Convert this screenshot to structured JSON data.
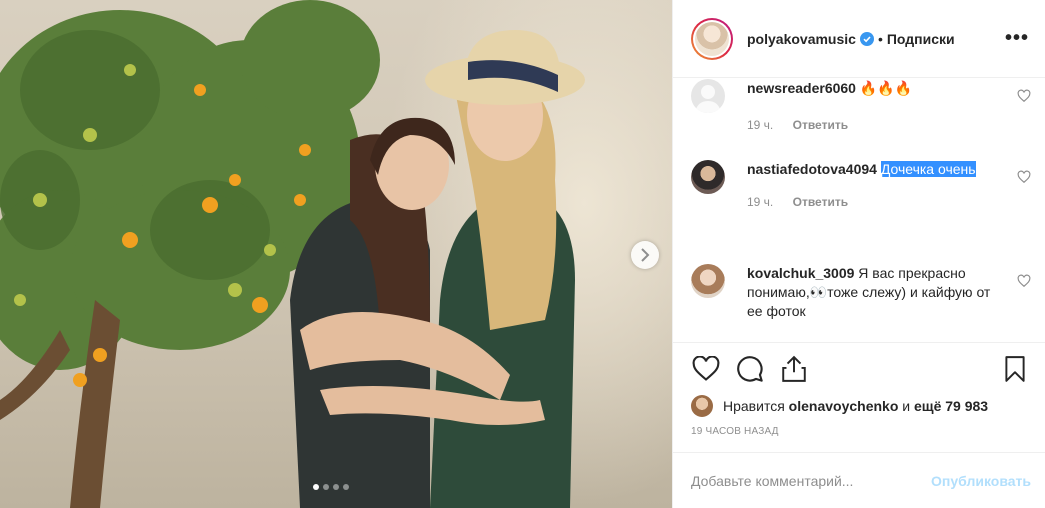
{
  "header": {
    "username": "polyakovamusic",
    "bullet": "•",
    "follow_label": "Подписки",
    "more_label": "•••"
  },
  "comments": [
    {
      "user": "newsreader6060",
      "text": "🔥🔥🔥",
      "time": "19 ч.",
      "reply": "Ответить"
    },
    {
      "user": "nastiafedotova4094",
      "text": "Дочечка очень",
      "time": "19 ч.",
      "reply": "Ответить"
    },
    {
      "user": "kovalchuk_3009",
      "text": "Я вас прекрасно понимаю,👀тоже слежу) и кайфую от ее фоток"
    }
  ],
  "likes": {
    "prefix": "Нравится",
    "user": "olenavoychenko",
    "middle": "и",
    "count": "ещё 79 983"
  },
  "time_ago": "19 ЧАСОВ НАЗАД",
  "comment_box": {
    "placeholder": "Добавьте комментарий...",
    "publish_label": "Опубликовать"
  },
  "carousel": {
    "active_index": 0,
    "count": 4
  },
  "colors": {
    "accent": "#0095f6",
    "publish_disabled": "#b2dffc",
    "meta": "#8e8e8e",
    "highlight": "#3390ff"
  }
}
